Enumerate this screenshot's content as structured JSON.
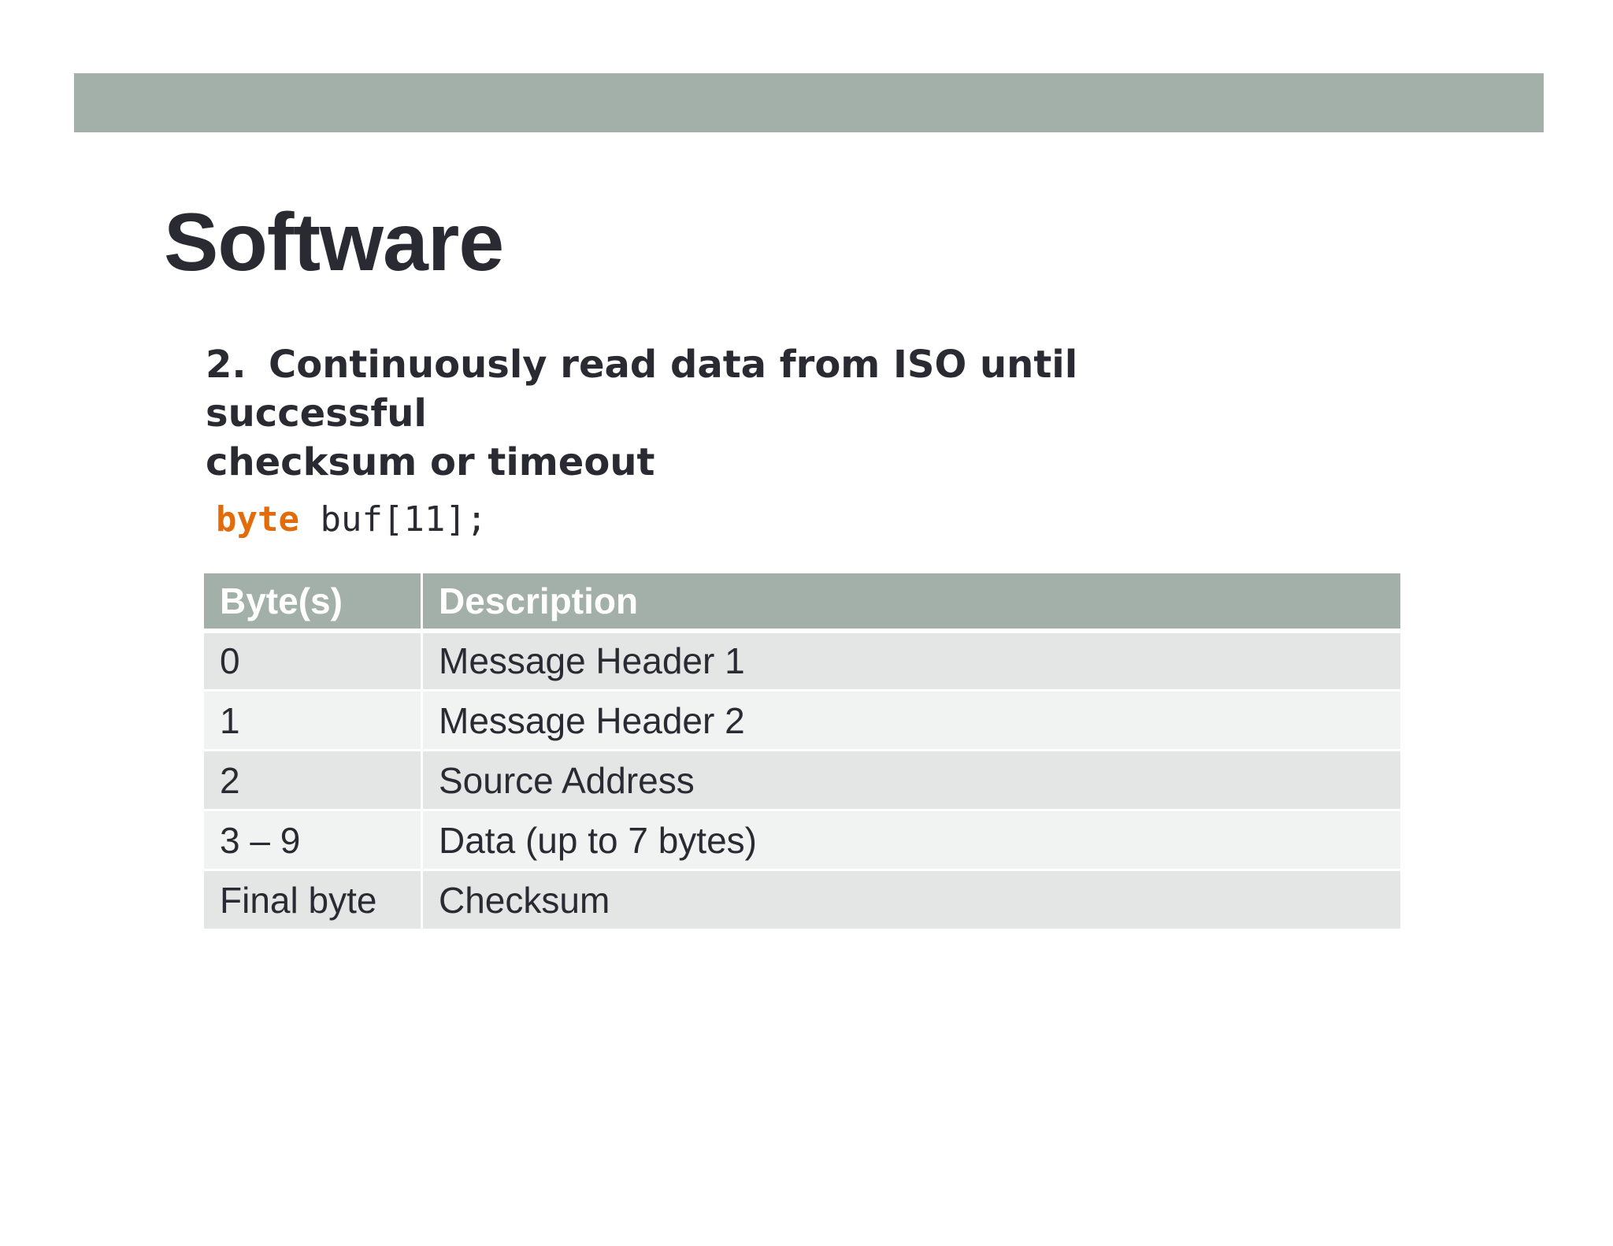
{
  "slide": {
    "title": "Software",
    "step_number": "2.",
    "step_text_line1": "Continuously read data from ISO until successful",
    "step_text_line2": "checksum or timeout"
  },
  "code": {
    "keyword": "byte",
    "rest": " buf[11];"
  },
  "table": {
    "headers": [
      "Byte(s)",
      "Description"
    ],
    "rows": [
      [
        "0",
        "Message Header 1"
      ],
      [
        "1",
        "Message Header 2"
      ],
      [
        "2",
        "Source Address"
      ],
      [
        "3 – 9",
        "Data (up to 7 bytes)"
      ],
      [
        "Final byte",
        "Checksum"
      ]
    ]
  },
  "colors": {
    "accent_bar": "#a3b0a9",
    "keyword": "#e36c0a",
    "row_dark": "#e4e6e5",
    "row_light": "#f1f3f2"
  }
}
